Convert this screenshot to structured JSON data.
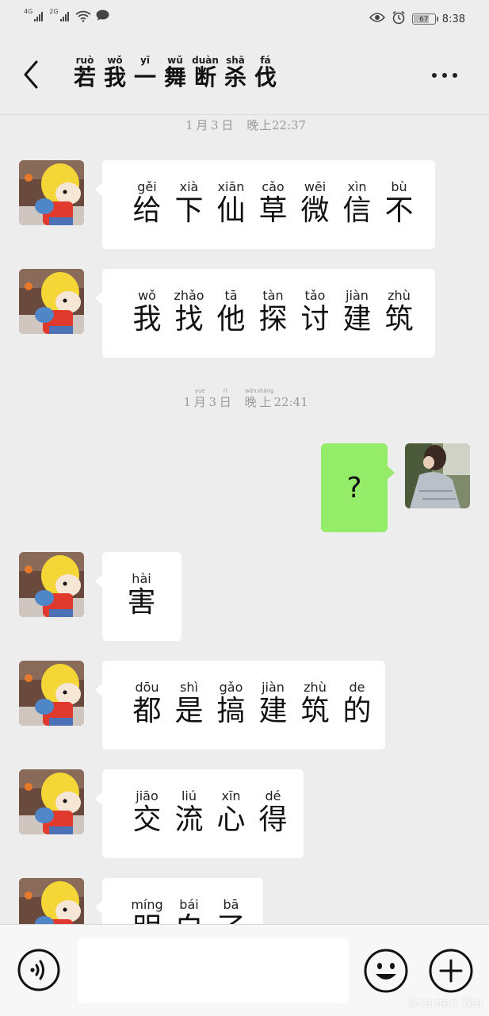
{
  "status_bar": {
    "signal1_label": "4G",
    "signal2_label": "2G",
    "battery": "67",
    "time": "8:38"
  },
  "header": {
    "title_chars": [
      "若",
      "我",
      "一",
      "舞",
      "断",
      "杀",
      "伐"
    ],
    "title_pinyin": [
      "ruò",
      "wǒ",
      "yī",
      "wǔ",
      "duàn",
      "shā",
      "fá"
    ]
  },
  "timestamps": [
    {
      "chars": [
        "1",
        "月",
        "3",
        "日",
        "",
        "晚",
        "上",
        "22:37"
      ],
      "pinyin": [
        "",
        "",
        "",
        "",
        "",
        "",
        "",
        ""
      ]
    },
    {
      "chars": [
        "1",
        "月",
        "3",
        "日",
        "",
        "晚",
        "上",
        "22:41"
      ],
      "pinyin": [
        "",
        "yuè",
        "",
        "rì",
        "",
        "wǎn",
        "shàng",
        ""
      ]
    }
  ],
  "messages": [
    {
      "chars": [
        "给",
        "下",
        "仙",
        "草",
        "微",
        "信",
        "不"
      ],
      "pinyin": [
        "gěi",
        "xià",
        "xiān",
        "cǎo",
        "wēi",
        "xìn",
        "bù"
      ]
    },
    {
      "chars": [
        "我",
        "找",
        "他",
        "探",
        "讨",
        "建",
        "筑"
      ],
      "pinyin": [
        "wǒ",
        "zhǎo",
        "tā",
        "tàn",
        "tǎo",
        "jiàn",
        "zhù"
      ]
    },
    {
      "text": "?"
    },
    {
      "chars": [
        "害"
      ],
      "pinyin": [
        "hài"
      ]
    },
    {
      "chars": [
        "都",
        "是",
        "搞",
        "建",
        "筑",
        "的"
      ],
      "pinyin": [
        "dōu",
        "shì",
        "gǎo",
        "jiàn",
        "zhù",
        "de"
      ]
    },
    {
      "chars": [
        "交",
        "流",
        "心",
        "得"
      ],
      "pinyin": [
        "jiāo",
        "liú",
        "xīn",
        "dé"
      ]
    },
    {
      "chars": [
        "明",
        "白",
        "了"
      ],
      "pinyin": [
        "míng",
        "bái",
        "bā"
      ]
    }
  ],
  "watermark": "Scented Tea",
  "colors": {
    "background": "#ededed",
    "my_bubble": "#95ec69",
    "their_bubble": "#ffffff",
    "input_bar": "#f7f7f7"
  },
  "icons": {
    "back": "chevron-left-icon",
    "more": "more-dots-icon",
    "voice": "voice-icon",
    "emoji": "emoji-icon",
    "plus": "plus-icon"
  }
}
